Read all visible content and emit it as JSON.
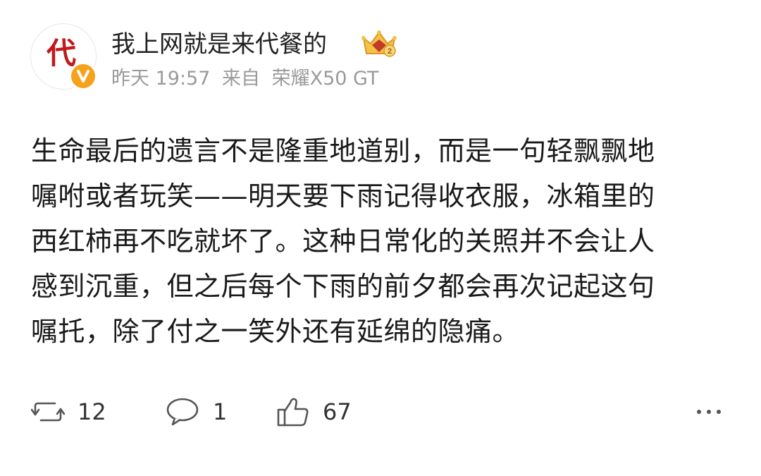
{
  "author": {
    "avatar_text": "代",
    "name": "我上网就是来代餐的",
    "verified_badge_icon": "v-verified-badge-icon",
    "rank_badge_icon": "gold-crown-badge-icon",
    "rank_badge_number": "2"
  },
  "meta": {
    "time": "昨天 19:57",
    "source_prefix": "来自",
    "device": "荣耀X50 GT"
  },
  "post": {
    "lines": [
      "生命最后的遗言不是隆重地道别，而是一句轻飘飘地",
      "嘱咐或者玩笑——明天要下雨记得收衣服，冰箱里的",
      "西红柿再不吃就坏了。这种日常化的关照并不会让人",
      "感到沉重，但之后每个下雨的前夕都会再次记起这句",
      "嘱托，除了付之一笑外还有延绵的隐痛。"
    ]
  },
  "actions": {
    "repost_count": "12",
    "comment_count": "1",
    "like_count": "67",
    "repost_icon": "repost-icon",
    "comment_icon": "comment-icon",
    "like_icon": "thumbs-up-icon",
    "more_icon": "more-dots-icon"
  },
  "colors": {
    "avatar_text": "#c01a1a",
    "verify_badge": "#f6a21b",
    "meta_text": "#9a9a9a",
    "body_text": "#1a1a1a",
    "icon_stroke": "#555555"
  }
}
